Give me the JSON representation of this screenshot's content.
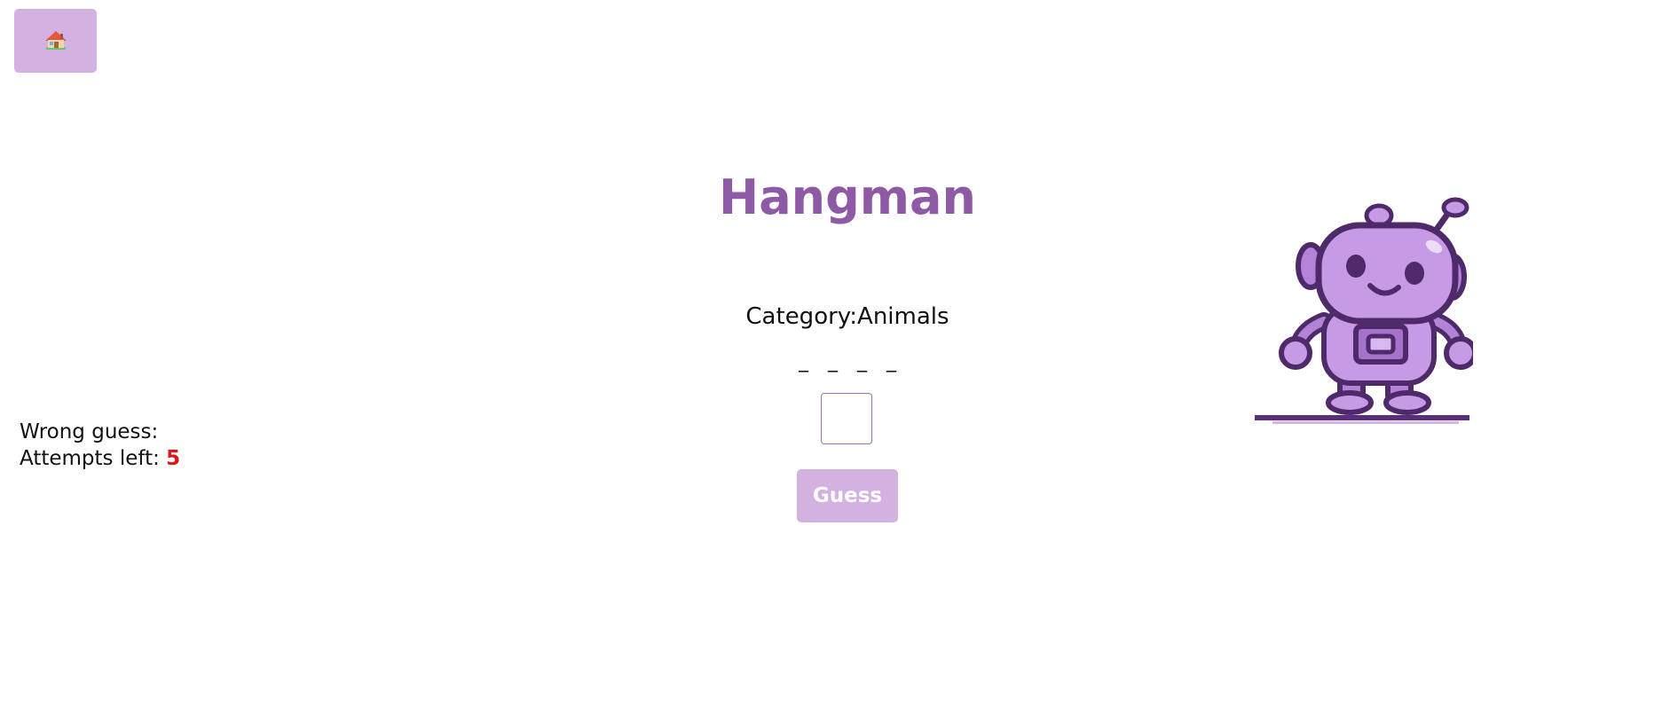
{
  "home": {
    "icon": "house-icon"
  },
  "game": {
    "title": "Hangman",
    "category_label": "Category:",
    "category_value": "Animals",
    "blanks": [
      "_",
      "_",
      "_",
      "_"
    ],
    "letter_input_value": "",
    "guess_label": "Guess",
    "wrong_guess_label": "Wrong guess:",
    "wrong_guesses": "",
    "attempts_label": "Attempts left:",
    "attempts_left": "5"
  },
  "robot": {
    "icon": "robot-icon"
  },
  "colors": {
    "accent": "#8e5aa6",
    "button_bg": "#d3b1e0",
    "attempts_color": "#e01212",
    "robot_fill": "#c79ae6",
    "robot_outline": "#4e2a6b"
  }
}
